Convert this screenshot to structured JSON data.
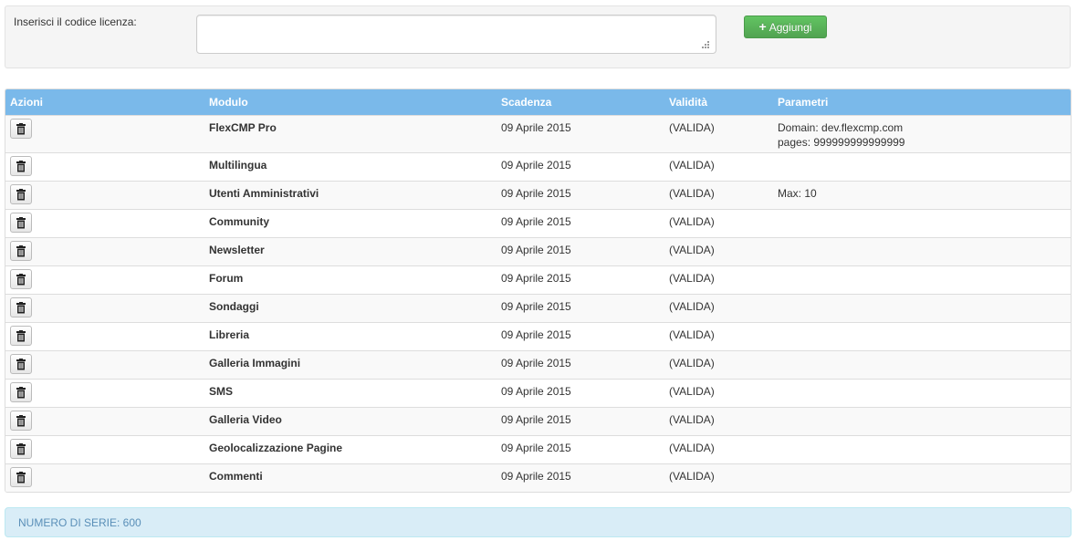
{
  "license_form": {
    "label": "Inserisci il codice licenza:",
    "input_value": "",
    "add_button_label": "Aggiungi",
    "add_icon": "plus-icon"
  },
  "table": {
    "headers": {
      "azioni": "Azioni",
      "modulo": "Modulo",
      "scadenza": "Scadenza",
      "validita": "Validità",
      "parametri": "Parametri"
    },
    "delete_icon": "trash-icon",
    "rows": [
      {
        "modulo": "FlexCMP Pro",
        "scadenza": "09 Aprile 2015",
        "validita": "(VALIDA)",
        "param1": "Domain: dev.flexcmp.com",
        "param2": "pages: 999999999999999"
      },
      {
        "modulo": "Multilingua",
        "scadenza": "09 Aprile 2015",
        "validita": "(VALIDA)",
        "param1": "",
        "param2": ""
      },
      {
        "modulo": "Utenti Amministrativi",
        "scadenza": "09 Aprile 2015",
        "validita": "(VALIDA)",
        "param1": "Max: 10",
        "param2": ""
      },
      {
        "modulo": "Community",
        "scadenza": "09 Aprile 2015",
        "validita": "(VALIDA)",
        "param1": "",
        "param2": ""
      },
      {
        "modulo": "Newsletter",
        "scadenza": "09 Aprile 2015",
        "validita": "(VALIDA)",
        "param1": "",
        "param2": ""
      },
      {
        "modulo": "Forum",
        "scadenza": "09 Aprile 2015",
        "validita": "(VALIDA)",
        "param1": "",
        "param2": ""
      },
      {
        "modulo": "Sondaggi",
        "scadenza": "09 Aprile 2015",
        "validita": "(VALIDA)",
        "param1": "",
        "param2": ""
      },
      {
        "modulo": "Libreria",
        "scadenza": "09 Aprile 2015",
        "validita": "(VALIDA)",
        "param1": "",
        "param2": ""
      },
      {
        "modulo": "Galleria Immagini",
        "scadenza": "09 Aprile 2015",
        "validita": "(VALIDA)",
        "param1": "",
        "param2": ""
      },
      {
        "modulo": "SMS",
        "scadenza": "09 Aprile 2015",
        "validita": "(VALIDA)",
        "param1": "",
        "param2": ""
      },
      {
        "modulo": "Galleria Video",
        "scadenza": "09 Aprile 2015",
        "validita": "(VALIDA)",
        "param1": "",
        "param2": ""
      },
      {
        "modulo": "Geolocalizzazione Pagine",
        "scadenza": "09 Aprile 2015",
        "validita": "(VALIDA)",
        "param1": "",
        "param2": ""
      },
      {
        "modulo": "Commenti",
        "scadenza": "09 Aprile 2015",
        "validita": "(VALIDA)",
        "param1": "",
        "param2": ""
      }
    ]
  },
  "serial": {
    "text": "NUMERO DI SERIE: 600"
  },
  "colors": {
    "header_bg": "#7ab9ea",
    "add_button": "#5bb75b",
    "info_bg": "#d9edf7",
    "info_text": "#5a8fb8"
  }
}
